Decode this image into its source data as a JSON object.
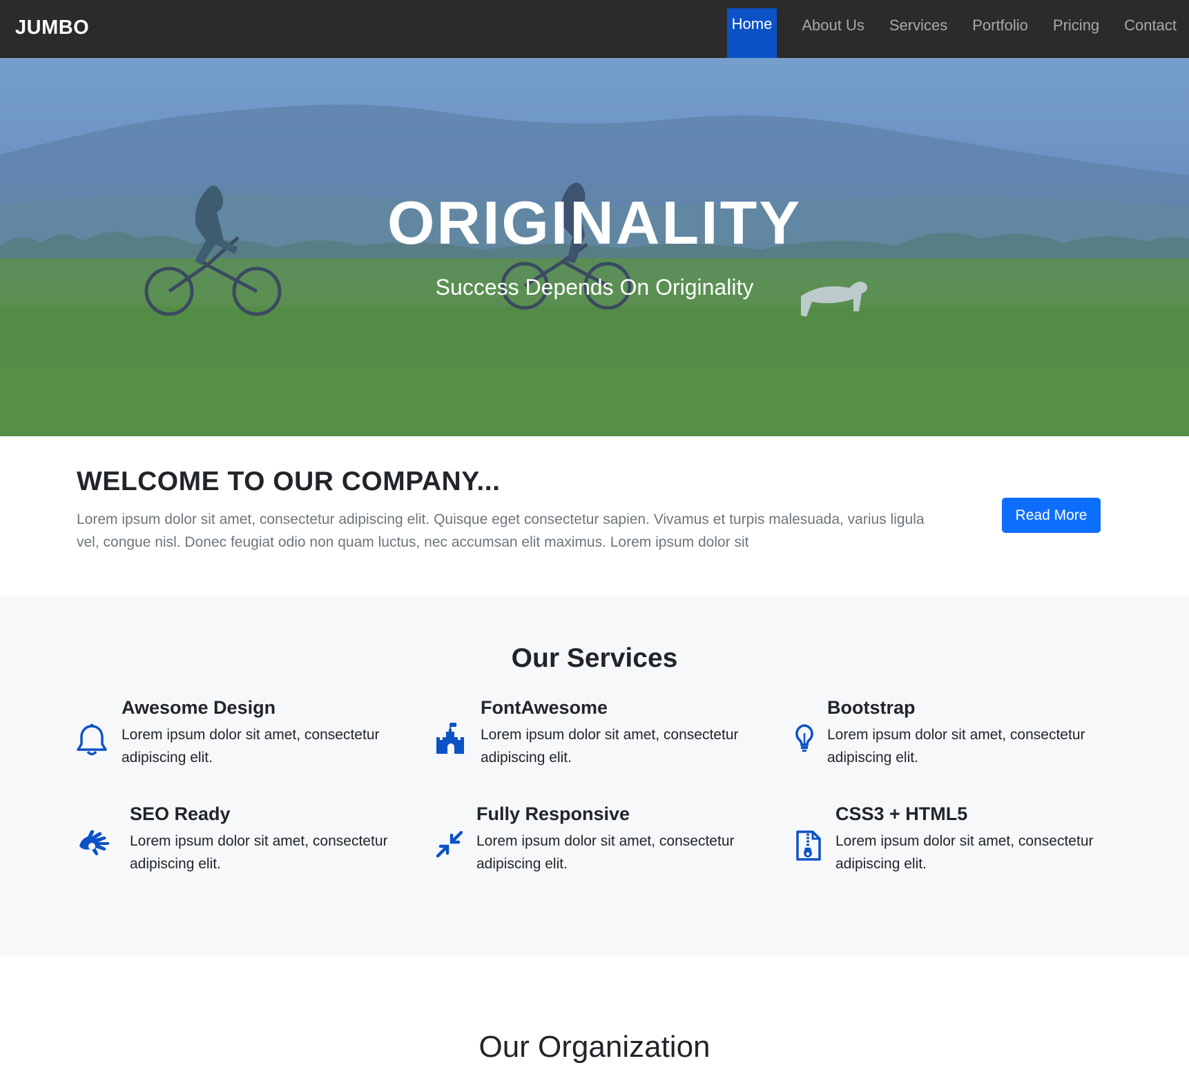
{
  "navbar": {
    "brand": "JUMBO",
    "items": [
      {
        "label": "Home",
        "active": true
      },
      {
        "label": "About Us",
        "active": false
      },
      {
        "label": "Services",
        "active": false
      },
      {
        "label": "Portfolio",
        "active": false
      },
      {
        "label": "Pricing",
        "active": false
      },
      {
        "label": "Contact",
        "active": false
      }
    ]
  },
  "hero": {
    "title": "ORIGINALITY",
    "subtitle": "Success Depends On Originality"
  },
  "welcome": {
    "heading": "WELCOME TO OUR COMPANY...",
    "text": "Lorem ipsum dolor sit amet, consectetur adipiscing elit. Quisque eget consectetur sapien. Vivamus et turpis malesuada, varius ligula vel, congue nisl. Donec feugiat odio non quam luctus, nec accumsan elit maximus. Lorem ipsum dolor sit",
    "button": "Read More"
  },
  "services": {
    "heading": "Our Services",
    "items": [
      {
        "title": "Awesome Design",
        "desc": "Lorem ipsum dolor sit amet, consectetur adipiscing elit.",
        "icon": "bell-icon"
      },
      {
        "title": "FontAwesome",
        "desc": "Lorem ipsum dolor sit amet, consectetur adipiscing elit.",
        "icon": "castle-icon"
      },
      {
        "title": "Bootstrap",
        "desc": "Lorem ipsum dolor sit amet, consectetur adipiscing elit.",
        "icon": "lightbulb-icon"
      },
      {
        "title": "SEO Ready",
        "desc": "Lorem ipsum dolor sit amet, consectetur adipiscing elit.",
        "icon": "sign-language-icon"
      },
      {
        "title": "Fully Responsive",
        "desc": "Lorem ipsum dolor sit amet, consectetur adipiscing elit.",
        "icon": "compress-arrows-icon"
      },
      {
        "title": "CSS3 + HTML5",
        "desc": "Lorem ipsum dolor sit amet, consectetur adipiscing elit.",
        "icon": "file-archive-icon"
      }
    ]
  },
  "organization": {
    "heading": "Our Organization"
  },
  "colors": {
    "navbar_bg": "#2b2b2b",
    "active_nav": "#0b52c7",
    "primary_button": "#0d6efd",
    "icon_blue": "#0b52c7",
    "services_bg": "#f7f8fa"
  }
}
